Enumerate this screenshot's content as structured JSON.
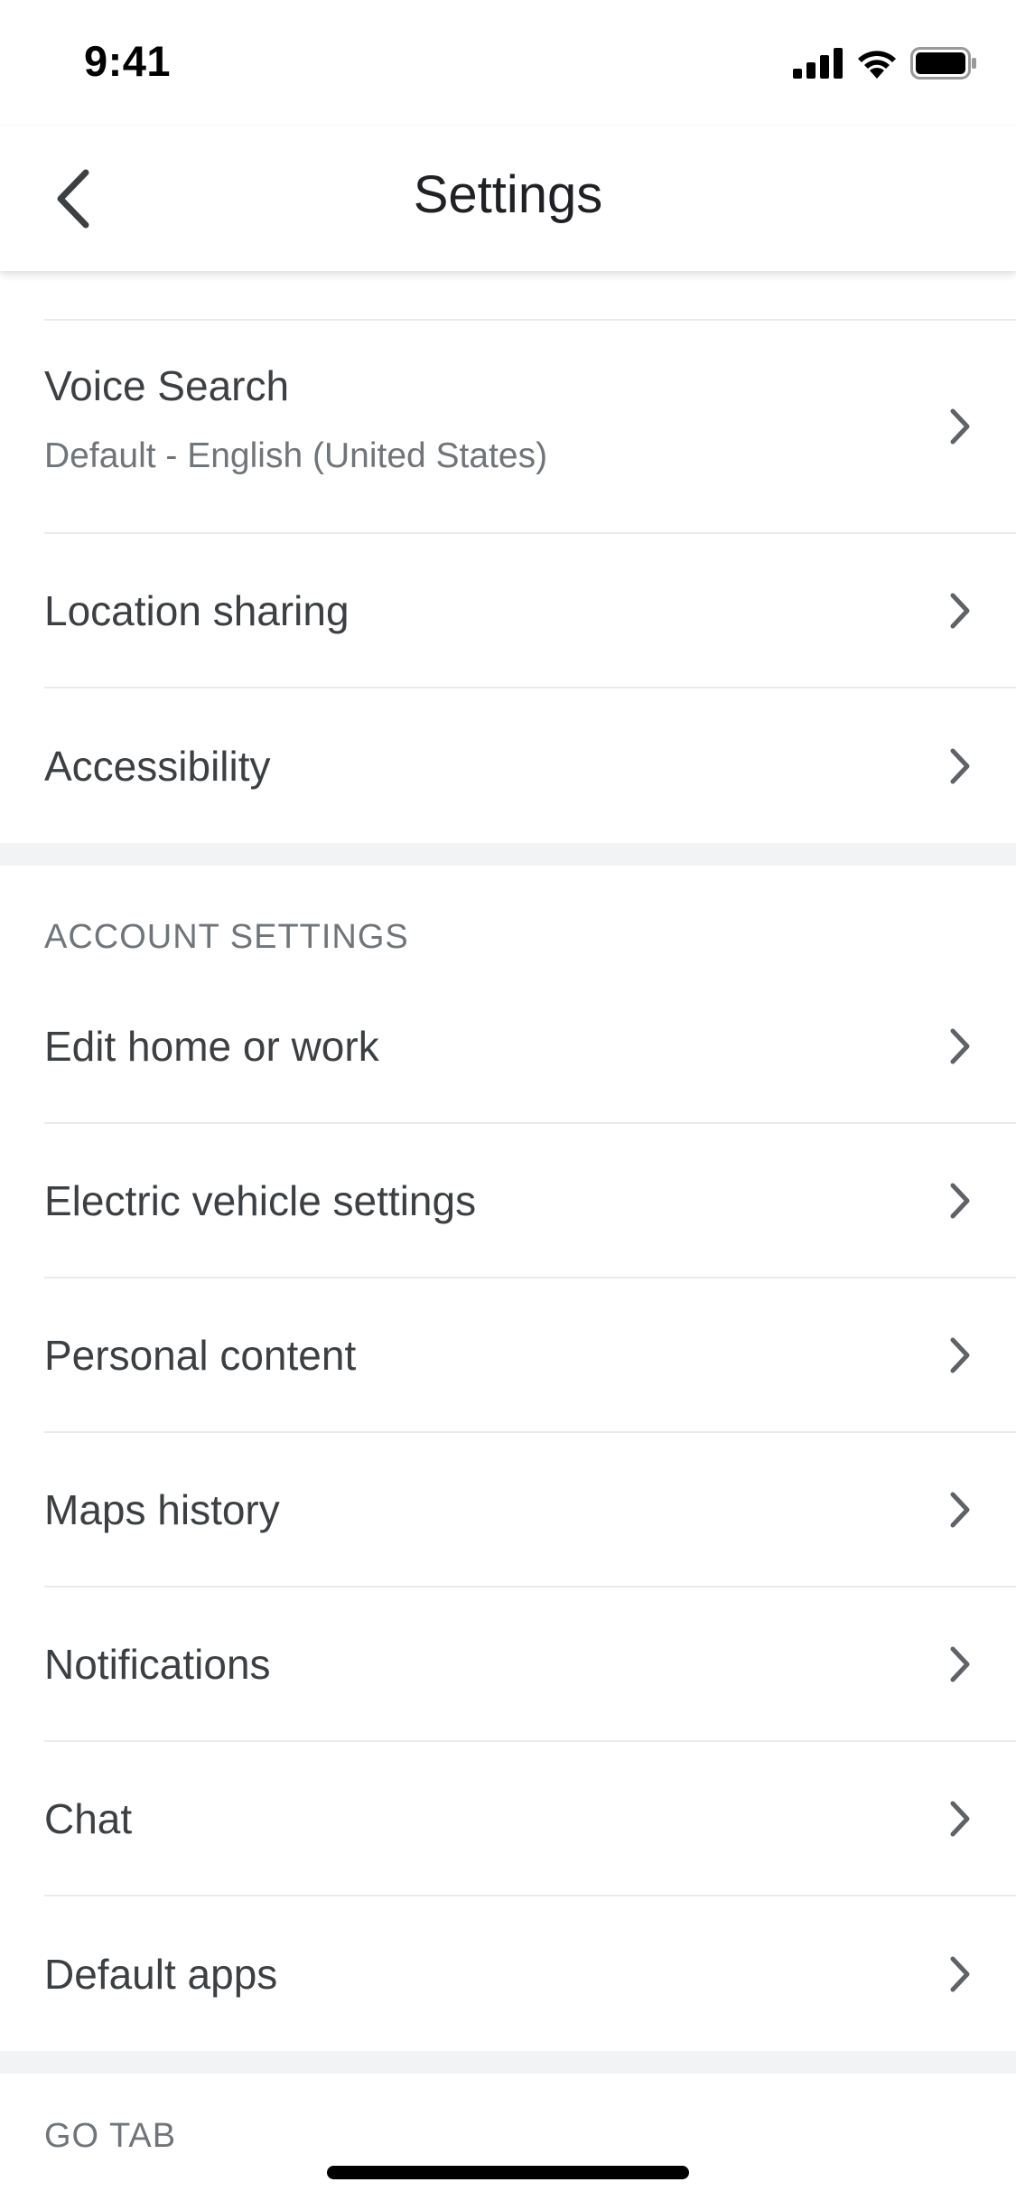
{
  "status_bar": {
    "time": "9:41",
    "icons": [
      "cellular-signal-icon",
      "wifi-icon",
      "battery-icon"
    ]
  },
  "header": {
    "title": "Settings",
    "back_icon": "chevron-left-icon"
  },
  "sections": {
    "general": {
      "items": [
        {
          "label": "Voice Search",
          "subtitle": "Default - English (United States)"
        },
        {
          "label": "Location sharing"
        },
        {
          "label": "Accessibility"
        }
      ]
    },
    "account": {
      "header": "ACCOUNT SETTINGS",
      "items": [
        {
          "label": "Edit home or work"
        },
        {
          "label": "Electric vehicle settings"
        },
        {
          "label": "Personal content"
        },
        {
          "label": "Maps history"
        },
        {
          "label": "Notifications"
        },
        {
          "label": "Chat"
        },
        {
          "label": "Default apps"
        }
      ]
    },
    "go_tab": {
      "header": "GO TAB"
    }
  },
  "colors": {
    "text_primary": "#3c4043",
    "text_secondary": "#70757a",
    "divider": "#e8eaed",
    "section_gap": "#f1f3f4",
    "chevron": "#5f6368"
  }
}
